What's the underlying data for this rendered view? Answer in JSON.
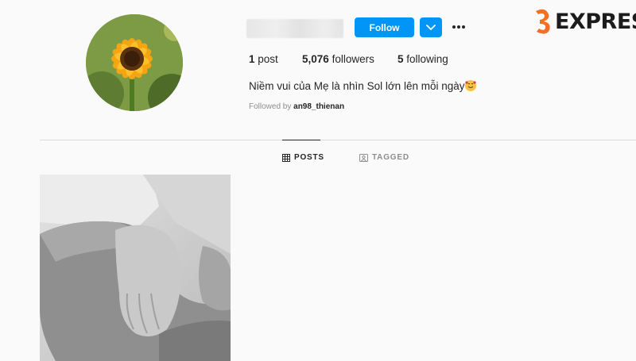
{
  "profile": {
    "follow_label": "Follow",
    "stats": {
      "posts_count": "1",
      "posts_label": "post",
      "followers_count": "5,076",
      "followers_label": "followers",
      "following_count": "5",
      "following_label": "following"
    },
    "bio": "Niềm vui của Mẹ là nhìn Sol lớn lên mỗi ngày",
    "followed_by_prefix": "Followed by",
    "followed_by_user": "an98_thienan"
  },
  "tabs": [
    {
      "label": "POSTS",
      "icon": "grid-icon",
      "active": true
    },
    {
      "label": "TAGGED",
      "icon": "tag-icon",
      "active": false
    }
  ],
  "watermark": {
    "text": "EXPRESS"
  },
  "colors": {
    "accent": "#0095f6",
    "logo_orange": "#f36f21"
  }
}
